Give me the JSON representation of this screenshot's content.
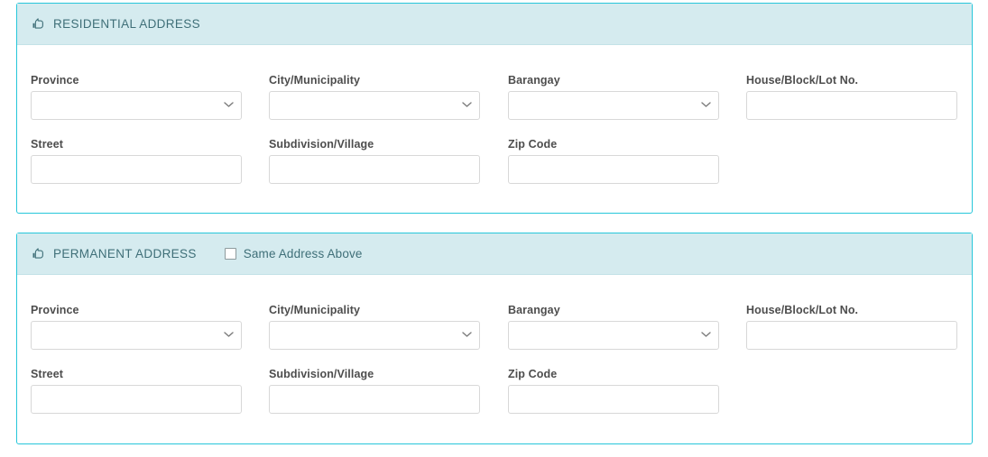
{
  "theme": {
    "panel_border": "#26c6da",
    "header_bg": "#d5ebef",
    "header_text": "#3f6f78",
    "label_text": "#4d4d4d",
    "input_border": "#d8d8d8"
  },
  "panels": [
    {
      "id": "residential-address",
      "icon": "hand-pointer-icon",
      "title": "RESIDENTIAL ADDRESS",
      "has_same_address_checkbox": false,
      "fields": [
        {
          "name": "province",
          "label": "Province",
          "type": "select",
          "value": "",
          "options": []
        },
        {
          "name": "city-municipality",
          "label": "City/Municipality",
          "type": "select",
          "value": "",
          "options": []
        },
        {
          "name": "barangay",
          "label": "Barangay",
          "type": "select",
          "value": "",
          "options": []
        },
        {
          "name": "house-block-lot",
          "label": "House/Block/Lot No.",
          "type": "text",
          "value": "",
          "placeholder": ""
        },
        {
          "name": "street",
          "label": "Street",
          "type": "text",
          "value": "",
          "placeholder": ""
        },
        {
          "name": "subdivision-village",
          "label": "Subdivision/Village",
          "type": "text",
          "value": "",
          "placeholder": ""
        },
        {
          "name": "zip-code",
          "label": "Zip Code",
          "type": "text",
          "value": "",
          "placeholder": ""
        }
      ]
    },
    {
      "id": "permanent-address",
      "icon": "hand-pointer-icon",
      "title": "PERMANENT ADDRESS",
      "has_same_address_checkbox": true,
      "same_address_label": "Same Address Above",
      "same_address_checked": false,
      "fields": [
        {
          "name": "province",
          "label": "Province",
          "type": "select",
          "value": "",
          "options": []
        },
        {
          "name": "city-municipality",
          "label": "City/Municipality",
          "type": "select",
          "value": "",
          "options": []
        },
        {
          "name": "barangay",
          "label": "Barangay",
          "type": "select",
          "value": "",
          "options": []
        },
        {
          "name": "house-block-lot",
          "label": "House/Block/Lot No.",
          "type": "text",
          "value": "",
          "placeholder": ""
        },
        {
          "name": "street",
          "label": "Street",
          "type": "text",
          "value": "",
          "placeholder": ""
        },
        {
          "name": "subdivision-village",
          "label": "Subdivision/Village",
          "type": "text",
          "value": "",
          "placeholder": ""
        },
        {
          "name": "zip-code",
          "label": "Zip Code",
          "type": "text",
          "value": "",
          "placeholder": ""
        }
      ]
    }
  ]
}
